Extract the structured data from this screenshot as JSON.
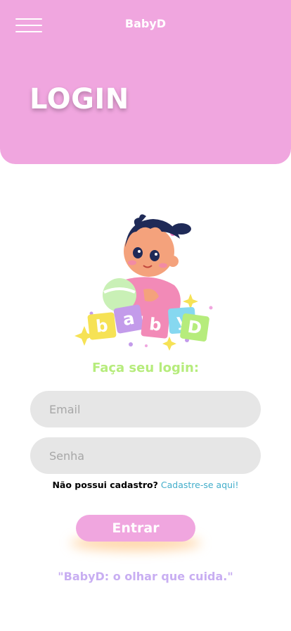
{
  "header": {
    "app_title": "BabyD",
    "page_title": "LOGIN",
    "menu_icon": "hamburger-menu-icon",
    "background_color": "#f0a6df"
  },
  "logo": {
    "icon": "baby-with-blocks-logo",
    "block_letters": [
      "b",
      "a",
      "b",
      "y",
      "D"
    ]
  },
  "form": {
    "heading": "Faça seu login:",
    "email": {
      "placeholder": "Email",
      "value": ""
    },
    "password": {
      "placeholder": "Senha",
      "value": ""
    },
    "signup_question": "Não possui cadastro?",
    "signup_link": "Cadastre-se aqui!",
    "submit_label": "Entrar"
  },
  "footer": {
    "tagline": "\"BabyD:  o olhar que cuida.\""
  },
  "colors": {
    "primary_pink": "#f0a6df",
    "heading_green": "#b6ec7c",
    "link_blue": "#43aecb",
    "tagline_lavender": "#c8aef2",
    "input_gray": "#e6e6e6"
  }
}
